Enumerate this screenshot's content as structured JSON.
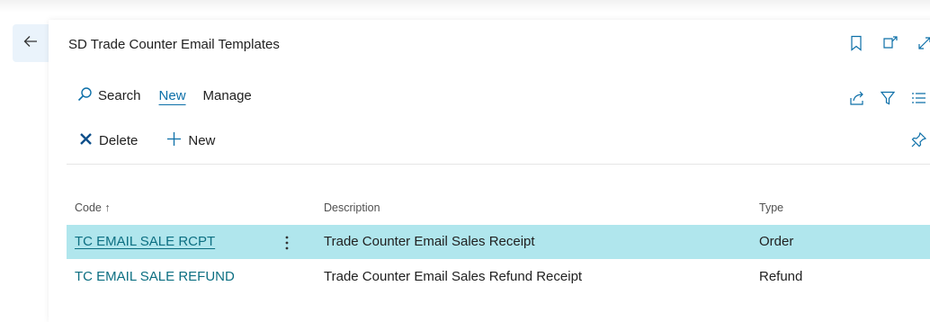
{
  "header": {
    "title": "SD Trade Counter Email Templates"
  },
  "actions": {
    "search_label": "Search",
    "new_tab_label": "New",
    "manage_label": "Manage"
  },
  "sub_actions": {
    "delete_label": "Delete",
    "new_label": "New"
  },
  "table": {
    "columns": {
      "code": "Code ↑",
      "description": "Description",
      "type": "Type"
    },
    "rows": [
      {
        "code": "TC EMAIL SALE RCPT",
        "description": "Trade Counter Email Sales Receipt",
        "type": "Order",
        "selected": true
      },
      {
        "code": "TC EMAIL SALE REFUND",
        "description": "Trade Counter Email Sales Refund Receipt",
        "type": "Refund",
        "selected": false
      }
    ]
  },
  "icons": {
    "back": "arrow-left-icon",
    "bookmark": "bookmark-icon",
    "open_new_window": "open-new-window-icon",
    "expand": "expand-icon",
    "search": "search-icon",
    "share": "share-icon",
    "filter": "filter-icon",
    "list": "list-icon",
    "delete": "close-icon",
    "add": "plus-icon",
    "pin": "pin-icon",
    "row_menu": "more-vertical-icon"
  },
  "colors": {
    "accent": "#0c6fa8",
    "link": "#0c6f82",
    "selected_row": "#b0e6ed"
  }
}
